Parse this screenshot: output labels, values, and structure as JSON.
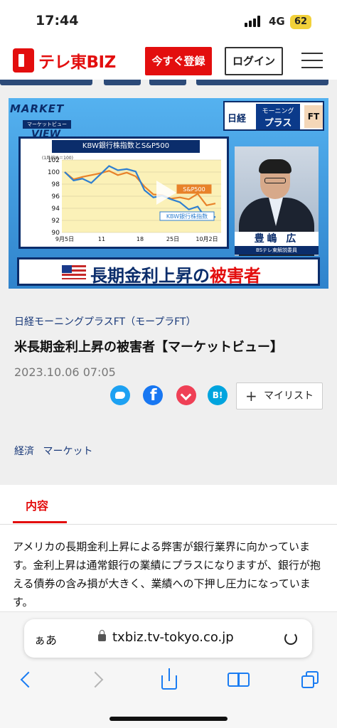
{
  "status_bar": {
    "time": "17:44",
    "network": "4G",
    "battery": "62"
  },
  "header": {
    "logo_text": "テレ東BIZ",
    "register_label": "今すぐ登録",
    "login_label": "ログイン",
    "menu_icon": "hamburger-icon"
  },
  "video": {
    "market_view_line1": "MARKET",
    "market_view_line2": "マーケットビュー",
    "market_view_line3": "VIEW",
    "sponsor_nikkei": "日経",
    "sponsor_morning": "モーニング",
    "sponsor_plus": "プラス",
    "sponsor_ft": "FT",
    "chart_title": "KBW銀行株指数とS&P500",
    "chart_unit": "(1月初め＝100)",
    "presenter_name": "豊嶋 広",
    "presenter_role": "BSテレ東解説委員",
    "banner_text_a": "長期金利上昇の",
    "banner_text_b": "被害者"
  },
  "chart_data": {
    "type": "line",
    "title": "KBW銀行株指数とS&P500",
    "ylim": [
      90,
      102
    ],
    "yticks": [
      "102",
      "100",
      "98",
      "96",
      "94",
      "92",
      "90"
    ],
    "xticks": [
      "9月5日",
      "11",
      "18",
      "25日",
      "10月2日"
    ],
    "series": [
      {
        "name": "S&P500",
        "color": "#e8822a",
        "values": [
          100,
          98.8,
          99.2,
          99.5,
          99.8,
          100.2,
          99.5,
          99.9,
          99.3,
          97.6,
          96.3,
          96.2,
          95.6,
          95.8,
          95.5,
          96.4,
          94.5,
          94.8
        ]
      },
      {
        "name": "KBW銀行株指数",
        "color": "#2f7fd0",
        "values": [
          100,
          98.6,
          98.9,
          98.2,
          99.6,
          101.0,
          100.3,
          100.5,
          100.1,
          97.0,
          95.8,
          96.1,
          95.5,
          95.0,
          93.8,
          94.3,
          92.2,
          92.6
        ]
      }
    ]
  },
  "article": {
    "program": "日経モーニングプラスFT（モープラFT）",
    "title": "米長期金利上昇の被害者【マーケットビュー】",
    "date": "2023.10.06 07:05",
    "mylist_label": "マイリスト",
    "tags": [
      "経済",
      "マーケット"
    ],
    "section_tab": "内容",
    "description": "アメリカの長期金利上昇による弊害が銀行業界に向かっています。金利上昇は通常銀行の業績にプラスになりますが、銀行が抱える債券の含み損が大きく、業績への下押し圧力になっています。"
  },
  "share": {
    "hatena_label": "B!"
  },
  "browser": {
    "aa_label": "ぁあ",
    "url": "txbiz.tv-tokyo.co.jp"
  }
}
